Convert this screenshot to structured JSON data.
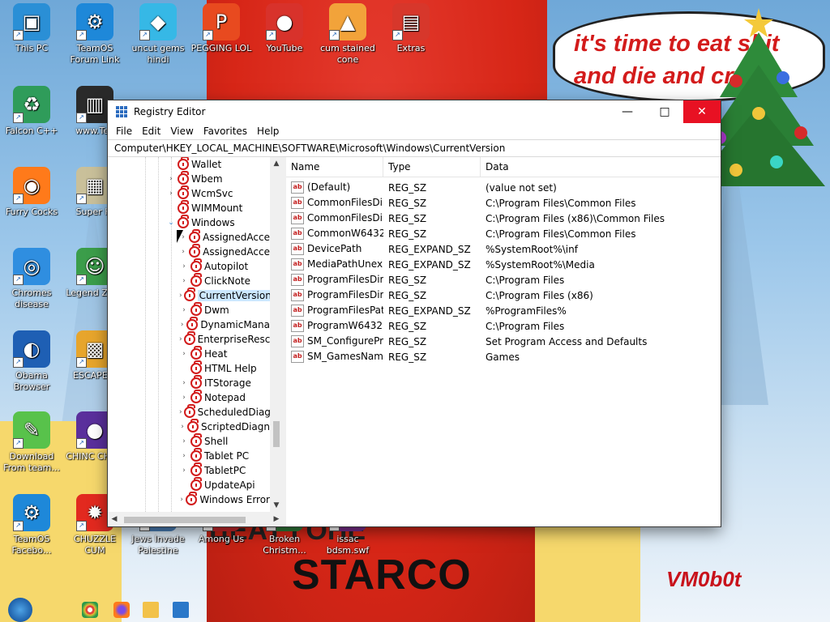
{
  "wallpaper": {
    "bubble_text": "it's time to eat shit and die and cry",
    "bottom_text": "STARCO",
    "partial_text": "ЦЕАТ ГОНЕ",
    "signature": "VM0b0t"
  },
  "desktop_icons": [
    {
      "label": "This PC",
      "icon": "monitor-icon",
      "color": "#2a8fd6"
    },
    {
      "label": "TeamOS Forum Link",
      "icon": "gear-icon",
      "color": "#1e88d9"
    },
    {
      "label": "uncut gems hindi",
      "icon": "gem-icon",
      "color": "#36b8e6"
    },
    {
      "label": "PEGGING LOL",
      "icon": "peggle-icon",
      "color": "#e84a1f"
    },
    {
      "label": "YouTube",
      "icon": "angry-bird-icon",
      "color": "#d8322b"
    },
    {
      "label": "cum stained cone",
      "icon": "cone-icon",
      "color": "#f2a33a"
    },
    {
      "label": "Extras",
      "icon": "gift-icon",
      "color": "#d7372b"
    },
    {
      "label": "Falcon C++",
      "icon": "recycle-icon",
      "color": "#2f9c5a"
    },
    {
      "label": "www.Tea",
      "icon": "book-icon",
      "color": "#2a2a2a"
    },
    {
      "label": "Furry Cocks",
      "icon": "firefox-icon",
      "color": "#ff7a1a"
    },
    {
      "label": "Super Hi",
      "icon": "pixel-icon",
      "color": "#c9c09a"
    },
    {
      "label": "Chromes disease",
      "icon": "chrome-icon",
      "color": "#2f8ee0"
    },
    {
      "label": "Legend Zilda",
      "icon": "zelda-icon",
      "color": "#3b9d4a"
    },
    {
      "label": "Obama Browser",
      "icon": "obama-icon",
      "color": "#1e5fb4"
    },
    {
      "label": "ESCAPE C",
      "icon": "mahjong-icon",
      "color": "#e7a52c"
    },
    {
      "label": "Download From team...",
      "icon": "notepad-icon",
      "color": "#58c24b"
    },
    {
      "label": "CHINC CHON",
      "icon": "ball-icon",
      "color": "#5a2f9c"
    },
    {
      "label": "TeamOS Facebo...",
      "icon": "gear-icon",
      "color": "#1e88d9"
    },
    {
      "label": "CHUZZLE CUM",
      "icon": "chuzzle-icon",
      "color": "#e2291f"
    },
    {
      "label": "Jews Invade Palestine",
      "icon": "game-icon",
      "color": "#4a7fb8"
    },
    {
      "label": "Among Us",
      "icon": "amongus-icon",
      "color": "#c7272a"
    },
    {
      "label": "Broken Christm...",
      "icon": "tree-icon",
      "color": "#2f7d3a"
    },
    {
      "label": "issac bdsm.swf",
      "icon": "swf-icon",
      "color": "#7b2d8f"
    }
  ],
  "registry": {
    "title": "Registry Editor",
    "menu": [
      "File",
      "Edit",
      "View",
      "Favorites",
      "Help"
    ],
    "address": "Computer\\HKEY_LOCAL_MACHINE\\SOFTWARE\\Microsoft\\Windows\\CurrentVersion",
    "tree": [
      {
        "label": "Wallet",
        "level": 1,
        "expander": ""
      },
      {
        "label": "Wbem",
        "level": 1,
        "expander": ">"
      },
      {
        "label": "WcmSvc",
        "level": 1,
        "expander": ">"
      },
      {
        "label": "WIMMount",
        "level": 1,
        "expander": ""
      },
      {
        "label": "Windows",
        "level": 1,
        "expander": "v"
      },
      {
        "label": "AssignedAcce",
        "level": 2,
        "expander": ">"
      },
      {
        "label": "AssignedAcce",
        "level": 2,
        "expander": ">"
      },
      {
        "label": "Autopilot",
        "level": 2,
        "expander": ">"
      },
      {
        "label": "ClickNote",
        "level": 2,
        "expander": ">"
      },
      {
        "label": "CurrentVersion",
        "level": 2,
        "expander": ">",
        "selected": true
      },
      {
        "label": "Dwm",
        "level": 2,
        "expander": ">"
      },
      {
        "label": "DynamicMana",
        "level": 2,
        "expander": ">"
      },
      {
        "label": "EnterpriseResc",
        "level": 2,
        "expander": ">"
      },
      {
        "label": "Heat",
        "level": 2,
        "expander": ">"
      },
      {
        "label": "HTML Help",
        "level": 2,
        "expander": ""
      },
      {
        "label": "ITStorage",
        "level": 2,
        "expander": ">"
      },
      {
        "label": "Notepad",
        "level": 2,
        "expander": ">"
      },
      {
        "label": "ScheduledDiag",
        "level": 2,
        "expander": ">"
      },
      {
        "label": "ScriptedDiagn",
        "level": 2,
        "expander": ">"
      },
      {
        "label": "Shell",
        "level": 2,
        "expander": ">"
      },
      {
        "label": "Tablet PC",
        "level": 2,
        "expander": ">"
      },
      {
        "label": "TabletPC",
        "level": 2,
        "expander": ">"
      },
      {
        "label": "UpdateApi",
        "level": 2,
        "expander": ""
      },
      {
        "label": "Windows Error",
        "level": 2,
        "expander": ">"
      }
    ],
    "columns": [
      "Name",
      "Type",
      "Data"
    ],
    "values": [
      {
        "name": "(Default)",
        "type": "REG_SZ",
        "data": "(value not set)"
      },
      {
        "name": "CommonFilesDir",
        "type": "REG_SZ",
        "data": "C:\\Program Files\\Common Files"
      },
      {
        "name": "CommonFilesDi...",
        "type": "REG_SZ",
        "data": "C:\\Program Files (x86)\\Common Files"
      },
      {
        "name": "CommonW6432...",
        "type": "REG_SZ",
        "data": "C:\\Program Files\\Common Files"
      },
      {
        "name": "DevicePath",
        "type": "REG_EXPAND_SZ",
        "data": "%SystemRoot%\\inf"
      },
      {
        "name": "MediaPathUnex...",
        "type": "REG_EXPAND_SZ",
        "data": "%SystemRoot%\\Media"
      },
      {
        "name": "ProgramFilesDir",
        "type": "REG_SZ",
        "data": "C:\\Program Files"
      },
      {
        "name": "ProgramFilesDir ...",
        "type": "REG_SZ",
        "data": "C:\\Program Files (x86)"
      },
      {
        "name": "ProgramFilesPath",
        "type": "REG_EXPAND_SZ",
        "data": "%ProgramFiles%"
      },
      {
        "name": "ProgramW6432Dir",
        "type": "REG_SZ",
        "data": "C:\\Program Files"
      },
      {
        "name": "SM_ConfigurePr...",
        "type": "REG_SZ",
        "data": "Set Program Access and Defaults"
      },
      {
        "name": "SM_GamesName",
        "type": "REG_SZ",
        "data": "Games"
      }
    ]
  }
}
